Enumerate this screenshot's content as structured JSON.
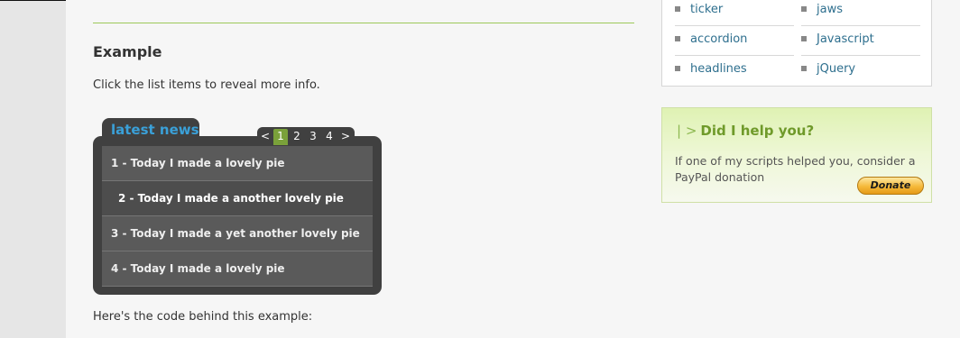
{
  "main": {
    "heading": "Example",
    "intro": "Click the list items to reveal more info.",
    "outro": "Here's the code behind this example:"
  },
  "widget": {
    "tab_label": "latest news",
    "pager": {
      "prev": "<",
      "pages": [
        "1",
        "2",
        "3",
        "4"
      ],
      "next": ">",
      "active_page": "1"
    },
    "items": [
      {
        "label": "1 - Today I made a lovely pie",
        "selected": false
      },
      {
        "label": "2 - Today I made a another lovely pie",
        "selected": true
      },
      {
        "label": "3 - Today I made a yet another lovely pie",
        "selected": false
      },
      {
        "label": "4 - Today I made a lovely pie",
        "selected": false
      }
    ]
  },
  "sidebar": {
    "links_left": [
      "ticker",
      "accordion",
      "headlines"
    ],
    "links_right": [
      "jaws",
      "Javascript",
      "jQuery"
    ],
    "donate": {
      "pipe": "| >",
      "title": "Did I help you?",
      "text": "If one of my scripts helped you, consider a PayPal donation",
      "button_label": "Donate"
    }
  },
  "colors": {
    "accent_green": "#7aa13a",
    "tab_blue": "#3aa0d8",
    "link_blue": "#2e6f8e",
    "widget_dark": "#404040"
  }
}
